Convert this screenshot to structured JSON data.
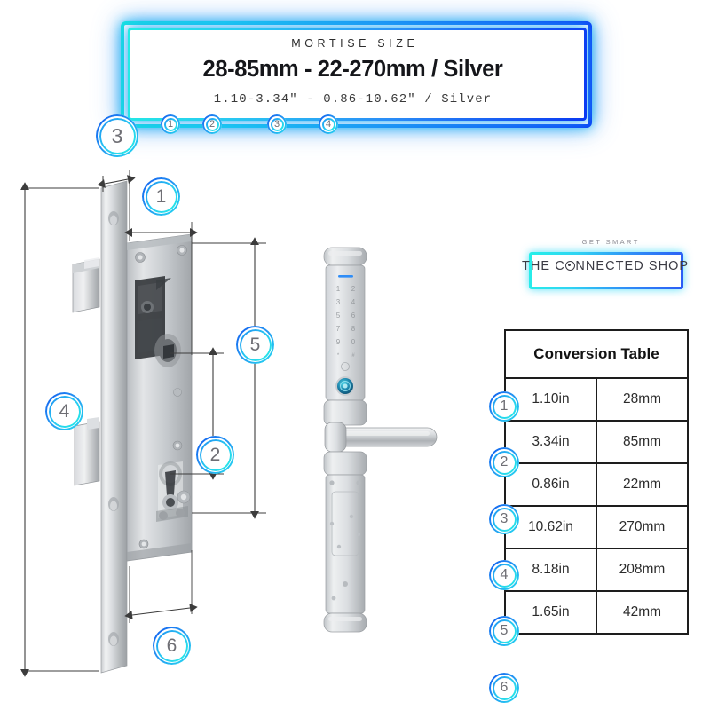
{
  "banner": {
    "kicker": "MORTISE SIZE",
    "headline": "28-85mm - 22-270mm / Silver",
    "subline": "1.10-3.34\" - 0.86-10.62\" / Silver",
    "accent_cyan": "#23ece4",
    "accent_blue": "#0a39f2",
    "markers": [
      "1",
      "2",
      "3",
      "4"
    ]
  },
  "diagram": {
    "callouts": [
      {
        "id": "3",
        "label": "3",
        "size": "large"
      },
      {
        "id": "1",
        "label": "1",
        "size": "medium"
      },
      {
        "id": "5",
        "label": "5",
        "size": "medium"
      },
      {
        "id": "4",
        "label": "4",
        "size": "medium"
      },
      {
        "id": "2",
        "label": "2",
        "size": "medium"
      },
      {
        "id": "6",
        "label": "6",
        "size": "medium"
      }
    ]
  },
  "logo": {
    "kicker": "GET SMART",
    "name_before": "THE C",
    "name_after": "NNECTED SHOP"
  },
  "table": {
    "title": "Conversion Table",
    "rows": [
      {
        "marker": "1",
        "inches": "1.10in",
        "mm": "28mm"
      },
      {
        "marker": "2",
        "inches": "3.34in",
        "mm": "85mm"
      },
      {
        "marker": "3",
        "inches": "0.86in",
        "mm": "22mm"
      },
      {
        "marker": "4",
        "inches": "10.62in",
        "mm": "270mm"
      },
      {
        "marker": "5",
        "inches": "8.18in",
        "mm": "208mm"
      },
      {
        "marker": "6",
        "inches": "1.65in",
        "mm": "42mm"
      }
    ]
  }
}
